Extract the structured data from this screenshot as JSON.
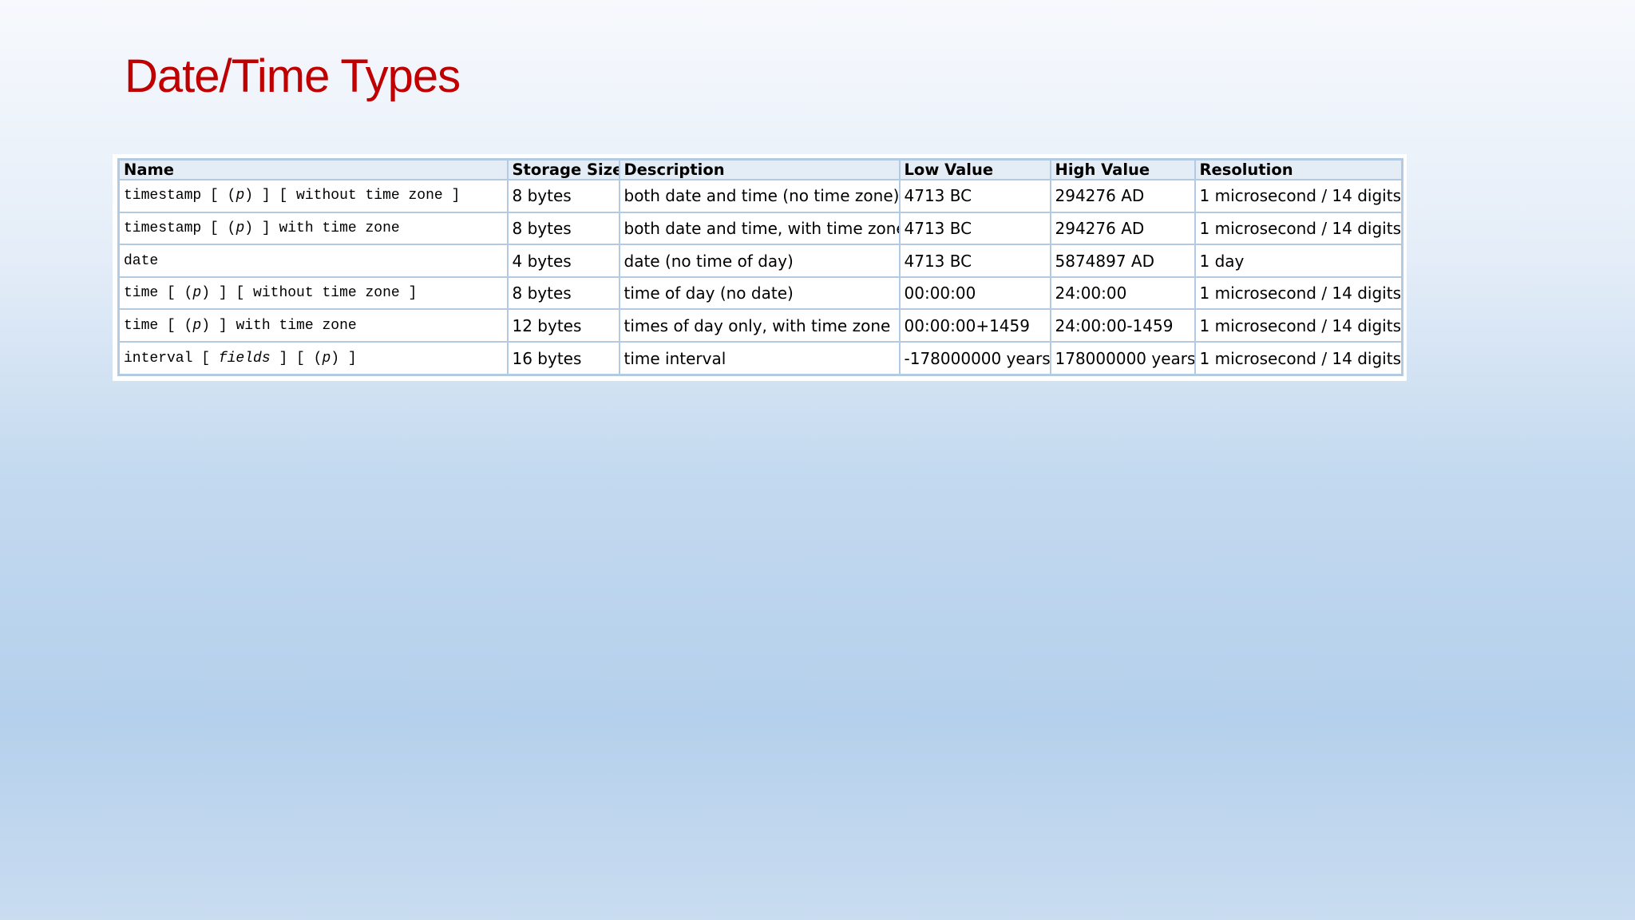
{
  "slide": {
    "title": "Date/Time Types"
  },
  "table": {
    "headers": [
      "Name",
      "Storage Size",
      "Description",
      "Low Value",
      "High Value",
      "Resolution"
    ],
    "rows": [
      {
        "name": [
          {
            "t": "timestamp [ ("
          },
          {
            "t": "p",
            "i": true
          },
          {
            "t": ") ] [ without time zone ]"
          }
        ],
        "size": "8 bytes",
        "description": "both date and time (no time zone)",
        "low": "4713 BC",
        "high": "294276 AD",
        "resolution": "1 microsecond / 14 digits"
      },
      {
        "name": [
          {
            "t": "timestamp [ ("
          },
          {
            "t": "p",
            "i": true
          },
          {
            "t": ") ] with time zone"
          }
        ],
        "size": "8 bytes",
        "description": "both date and time, with time zone",
        "low": "4713 BC",
        "high": "294276 AD",
        "resolution": "1 microsecond / 14 digits"
      },
      {
        "name": [
          {
            "t": "date"
          }
        ],
        "size": "4 bytes",
        "description": "date (no time of day)",
        "low": "4713 BC",
        "high": "5874897 AD",
        "resolution": "1 day"
      },
      {
        "name": [
          {
            "t": "time [ ("
          },
          {
            "t": "p",
            "i": true
          },
          {
            "t": ") ] [ without time zone ]"
          }
        ],
        "size": "8 bytes",
        "description": "time of day (no date)",
        "low": "00:00:00",
        "high": "24:00:00",
        "resolution": "1 microsecond / 14 digits"
      },
      {
        "name": [
          {
            "t": "time [ ("
          },
          {
            "t": "p",
            "i": true
          },
          {
            "t": ") ] with time zone"
          }
        ],
        "size": "12 bytes",
        "description": "times of day only, with time zone",
        "low": "00:00:00+1459",
        "high": "24:00:00-1459",
        "resolution": "1 microsecond / 14 digits"
      },
      {
        "name": [
          {
            "t": "interval [ "
          },
          {
            "t": "fields",
            "i": true
          },
          {
            "t": " ] [ ("
          },
          {
            "t": "p",
            "i": true
          },
          {
            "t": ") ]"
          }
        ],
        "size": "16 bytes",
        "description": "time interval",
        "low": "-178000000 years",
        "high": "178000000 years",
        "resolution": "1 microsecond / 14 digits"
      }
    ]
  },
  "colors": {
    "title": "#c00000",
    "table_border": "#b3cbe2",
    "header_background": "#e4edf6"
  }
}
